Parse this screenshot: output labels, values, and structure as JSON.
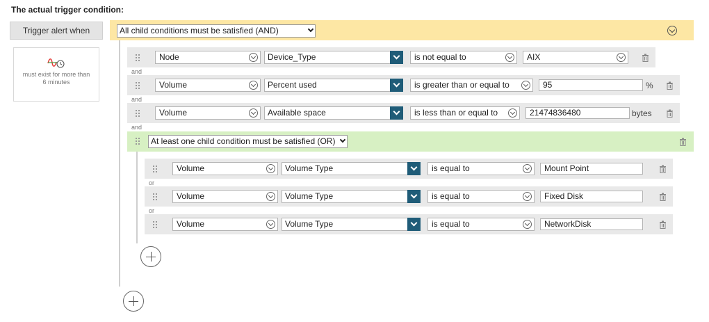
{
  "title": "The actual trigger condition:",
  "trigger_label": "Trigger alert when",
  "side_card": {
    "icon": "trend-time-icon",
    "text": "must exist for more than 6 minutes"
  },
  "top": {
    "selected": "All child conditions must be satisfied (AND)"
  },
  "and_rows": [
    {
      "object": "Node",
      "field": "Device_Type",
      "operator": "is not equal to",
      "value": "AIX",
      "unit": "",
      "conj": "and"
    },
    {
      "object": "Volume",
      "field": "Percent used",
      "operator": "is greater than or equal to",
      "value": "95",
      "unit": "%",
      "conj": "and"
    },
    {
      "object": "Volume",
      "field": "Available space",
      "operator": "is less than or equal to",
      "value": "21474836480",
      "unit": "bytes",
      "conj": "and"
    }
  ],
  "or_group": {
    "selected": "At least one child condition must be satisfied (OR)"
  },
  "or_rows": [
    {
      "object": "Volume",
      "field": "Volume Type",
      "operator": "is equal to",
      "value": "Mount Point",
      "conj": "or"
    },
    {
      "object": "Volume",
      "field": "Volume Type",
      "operator": "is equal to",
      "value": "Fixed Disk",
      "conj": "or"
    },
    {
      "object": "Volume",
      "field": "Volume Type",
      "operator": "is equal to",
      "value": "NetworkDisk"
    }
  ],
  "colors": {
    "and_bar": "#fde7a4",
    "or_bar": "#d7f0c3",
    "field_button": "#1f5c78",
    "row_bg": "#e9e9e9"
  }
}
